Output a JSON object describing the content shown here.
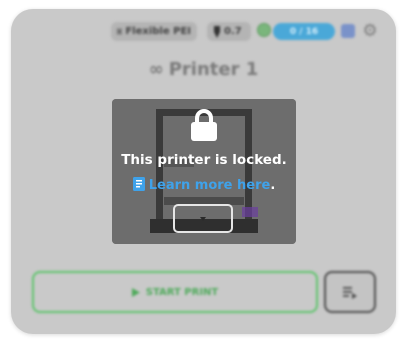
{
  "header": {
    "plate_chip_label": "Flexible PEI",
    "plate_icon": "plate-icon",
    "nozzle_chip_label": "0.7",
    "nozzle_icon": "nozzle-icon",
    "progress_label": "0 / 16",
    "status_color": "#7ab67c",
    "progress_color": "#4aa8d8",
    "settings_icon": "gear-icon"
  },
  "printer": {
    "name": "Printer 1",
    "name_icon": "infinity-icon"
  },
  "lock": {
    "icon": "lock-icon",
    "message": "This printer is locked.",
    "link_icon": "book-icon",
    "link_text": "Learn more here",
    "link_suffix": ".",
    "link_color": "#3fa2ea",
    "expand_icon": "chevron-down-icon"
  },
  "actions": {
    "start_label": "START PRINT",
    "start_icon": "play-icon",
    "start_color": "#5cc46a",
    "side_icon": "queue-icon"
  }
}
